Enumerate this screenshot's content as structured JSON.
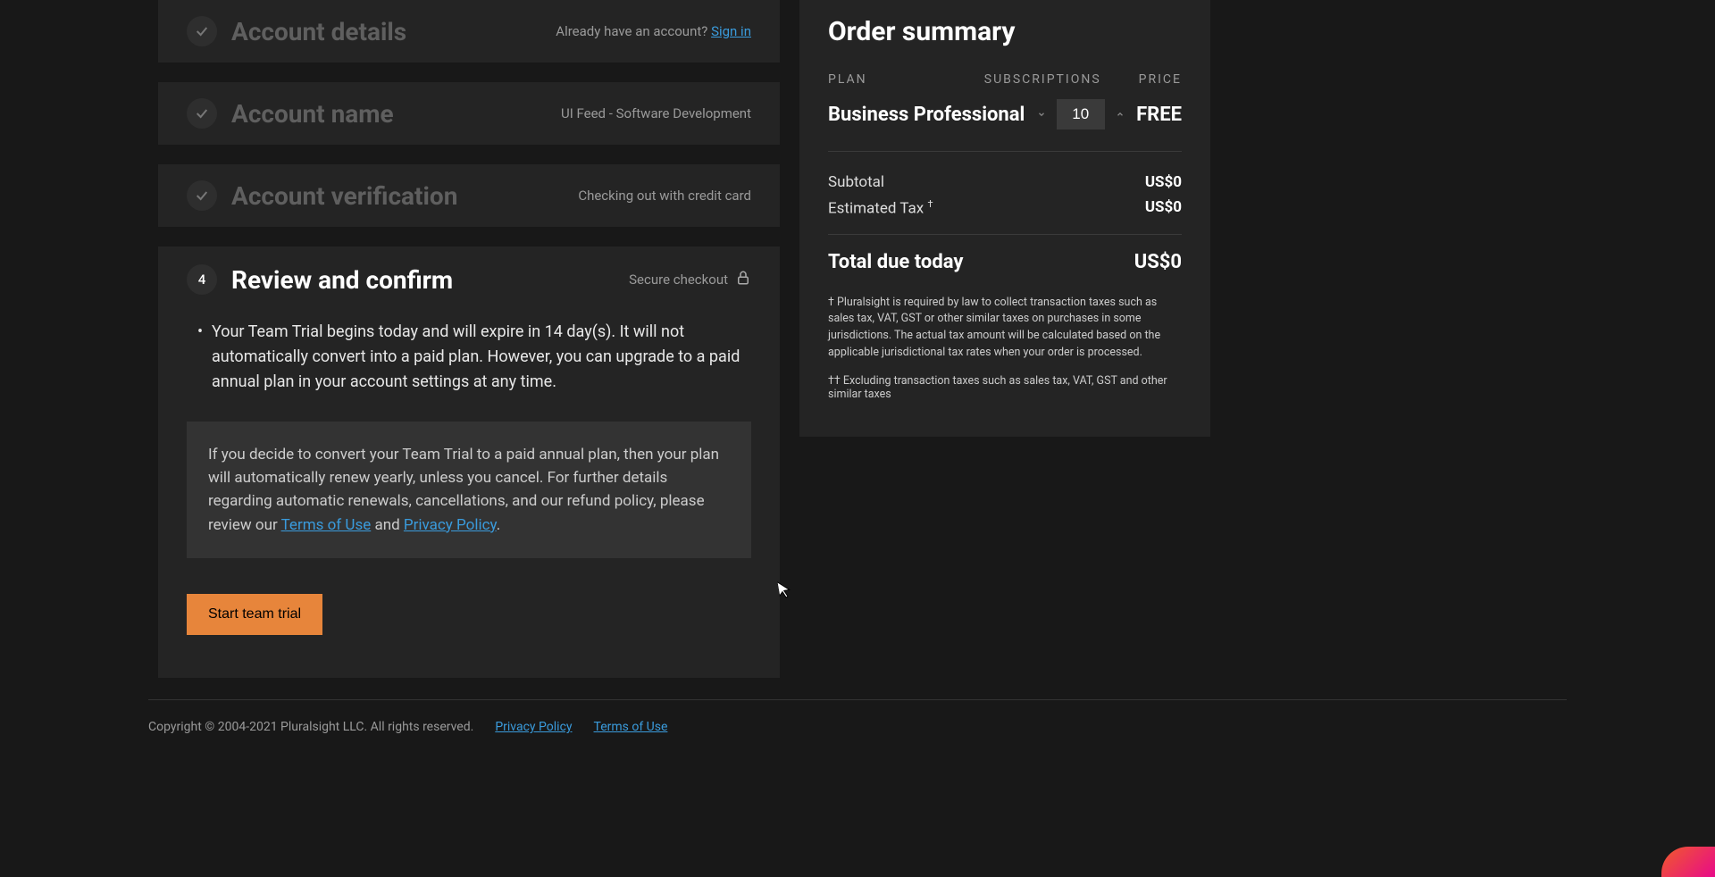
{
  "steps": {
    "details": {
      "title": "Account details",
      "right_prefix": "Already have an account? ",
      "right_link": "Sign in"
    },
    "name": {
      "title": "Account name",
      "right": "UI Feed - Software Development"
    },
    "verification": {
      "title": "Account verification",
      "right": "Checking out with credit card"
    },
    "review": {
      "number": "4",
      "title": "Review and confirm",
      "secure": "Secure checkout",
      "trial_text": "Your Team Trial begins today and will expire in 14 day(s). It will not automatically convert into a paid plan. However, you can upgrade to a paid annual plan in your account settings at any time.",
      "info_text_1": "If you decide to convert your Team Trial to a paid annual plan, then your plan will automatically renew yearly, unless you cancel. For further details regarding automatic renewals, cancellations, and our refund policy, please review our ",
      "info_terms": "Terms of Use",
      "info_and": " and ",
      "info_privacy": "Privacy Policy",
      "info_period": ".",
      "start_btn": "Start team trial"
    }
  },
  "summary": {
    "title": "Order summary",
    "headers": {
      "plan": "PLAN",
      "subs": "SUBSCRIPTIONS",
      "price": "PRICE"
    },
    "plan_name": "Business Professional",
    "quantity": "10",
    "price_label": "FREE",
    "subtotal_label": "Subtotal",
    "subtotal_value": "US$0",
    "tax_label": "Estimated Tax",
    "tax_sup": "†",
    "tax_value": "US$0",
    "total_label": "Total due today",
    "total_value": "US$0",
    "footnote1": "†   Pluralsight is required by law to collect transaction taxes such as sales tax, VAT, GST or other similar taxes on purchases in some jurisdictions. The actual tax amount will be calculated based on the applicable jurisdictional tax rates when your order is processed.",
    "footnote2": "††   Excluding transaction taxes such as sales tax, VAT, GST and other similar taxes"
  },
  "footer": {
    "copyright": "Copyright © 2004-2021 Pluralsight LLC. All rights reserved.",
    "privacy": "Privacy Policy",
    "terms": "Terms of Use"
  }
}
